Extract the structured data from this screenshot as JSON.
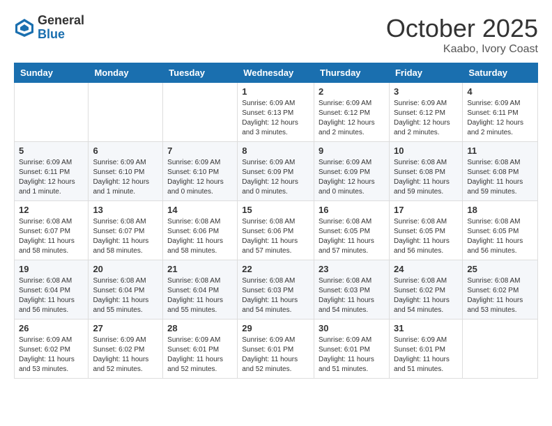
{
  "logo": {
    "general": "General",
    "blue": "Blue"
  },
  "header": {
    "month": "October 2025",
    "location": "Kaabo, Ivory Coast"
  },
  "weekdays": [
    "Sunday",
    "Monday",
    "Tuesday",
    "Wednesday",
    "Thursday",
    "Friday",
    "Saturday"
  ],
  "weeks": [
    [
      {
        "day": "",
        "info": ""
      },
      {
        "day": "",
        "info": ""
      },
      {
        "day": "",
        "info": ""
      },
      {
        "day": "1",
        "info": "Sunrise: 6:09 AM\nSunset: 6:13 PM\nDaylight: 12 hours\nand 3 minutes."
      },
      {
        "day": "2",
        "info": "Sunrise: 6:09 AM\nSunset: 6:12 PM\nDaylight: 12 hours\nand 2 minutes."
      },
      {
        "day": "3",
        "info": "Sunrise: 6:09 AM\nSunset: 6:12 PM\nDaylight: 12 hours\nand 2 minutes."
      },
      {
        "day": "4",
        "info": "Sunrise: 6:09 AM\nSunset: 6:11 PM\nDaylight: 12 hours\nand 2 minutes."
      }
    ],
    [
      {
        "day": "5",
        "info": "Sunrise: 6:09 AM\nSunset: 6:11 PM\nDaylight: 12 hours\nand 1 minute."
      },
      {
        "day": "6",
        "info": "Sunrise: 6:09 AM\nSunset: 6:10 PM\nDaylight: 12 hours\nand 1 minute."
      },
      {
        "day": "7",
        "info": "Sunrise: 6:09 AM\nSunset: 6:10 PM\nDaylight: 12 hours\nand 0 minutes."
      },
      {
        "day": "8",
        "info": "Sunrise: 6:09 AM\nSunset: 6:09 PM\nDaylight: 12 hours\nand 0 minutes."
      },
      {
        "day": "9",
        "info": "Sunrise: 6:09 AM\nSunset: 6:09 PM\nDaylight: 12 hours\nand 0 minutes."
      },
      {
        "day": "10",
        "info": "Sunrise: 6:08 AM\nSunset: 6:08 PM\nDaylight: 11 hours\nand 59 minutes."
      },
      {
        "day": "11",
        "info": "Sunrise: 6:08 AM\nSunset: 6:08 PM\nDaylight: 11 hours\nand 59 minutes."
      }
    ],
    [
      {
        "day": "12",
        "info": "Sunrise: 6:08 AM\nSunset: 6:07 PM\nDaylight: 11 hours\nand 58 minutes."
      },
      {
        "day": "13",
        "info": "Sunrise: 6:08 AM\nSunset: 6:07 PM\nDaylight: 11 hours\nand 58 minutes."
      },
      {
        "day": "14",
        "info": "Sunrise: 6:08 AM\nSunset: 6:06 PM\nDaylight: 11 hours\nand 58 minutes."
      },
      {
        "day": "15",
        "info": "Sunrise: 6:08 AM\nSunset: 6:06 PM\nDaylight: 11 hours\nand 57 minutes."
      },
      {
        "day": "16",
        "info": "Sunrise: 6:08 AM\nSunset: 6:05 PM\nDaylight: 11 hours\nand 57 minutes."
      },
      {
        "day": "17",
        "info": "Sunrise: 6:08 AM\nSunset: 6:05 PM\nDaylight: 11 hours\nand 56 minutes."
      },
      {
        "day": "18",
        "info": "Sunrise: 6:08 AM\nSunset: 6:05 PM\nDaylight: 11 hours\nand 56 minutes."
      }
    ],
    [
      {
        "day": "19",
        "info": "Sunrise: 6:08 AM\nSunset: 6:04 PM\nDaylight: 11 hours\nand 56 minutes."
      },
      {
        "day": "20",
        "info": "Sunrise: 6:08 AM\nSunset: 6:04 PM\nDaylight: 11 hours\nand 55 minutes."
      },
      {
        "day": "21",
        "info": "Sunrise: 6:08 AM\nSunset: 6:04 PM\nDaylight: 11 hours\nand 55 minutes."
      },
      {
        "day": "22",
        "info": "Sunrise: 6:08 AM\nSunset: 6:03 PM\nDaylight: 11 hours\nand 54 minutes."
      },
      {
        "day": "23",
        "info": "Sunrise: 6:08 AM\nSunset: 6:03 PM\nDaylight: 11 hours\nand 54 minutes."
      },
      {
        "day": "24",
        "info": "Sunrise: 6:08 AM\nSunset: 6:02 PM\nDaylight: 11 hours\nand 54 minutes."
      },
      {
        "day": "25",
        "info": "Sunrise: 6:08 AM\nSunset: 6:02 PM\nDaylight: 11 hours\nand 53 minutes."
      }
    ],
    [
      {
        "day": "26",
        "info": "Sunrise: 6:09 AM\nSunset: 6:02 PM\nDaylight: 11 hours\nand 53 minutes."
      },
      {
        "day": "27",
        "info": "Sunrise: 6:09 AM\nSunset: 6:02 PM\nDaylight: 11 hours\nand 52 minutes."
      },
      {
        "day": "28",
        "info": "Sunrise: 6:09 AM\nSunset: 6:01 PM\nDaylight: 11 hours\nand 52 minutes."
      },
      {
        "day": "29",
        "info": "Sunrise: 6:09 AM\nSunset: 6:01 PM\nDaylight: 11 hours\nand 52 minutes."
      },
      {
        "day": "30",
        "info": "Sunrise: 6:09 AM\nSunset: 6:01 PM\nDaylight: 11 hours\nand 51 minutes."
      },
      {
        "day": "31",
        "info": "Sunrise: 6:09 AM\nSunset: 6:01 PM\nDaylight: 11 hours\nand 51 minutes."
      },
      {
        "day": "",
        "info": ""
      }
    ]
  ]
}
